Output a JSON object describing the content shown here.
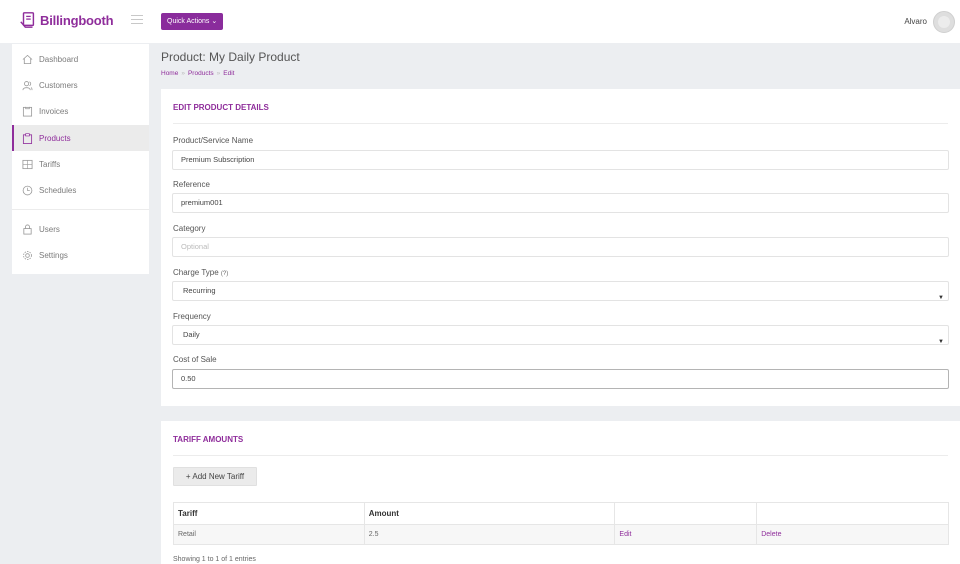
{
  "brand": {
    "name": "Billingbooth",
    "color": "#8f2d9b"
  },
  "header": {
    "quick_actions": "Quick Actions ⌄",
    "user": "Alvaro"
  },
  "sidebar": {
    "items": [
      {
        "label": "Dashboard",
        "icon": "home-icon"
      },
      {
        "label": "Customers",
        "icon": "users-icon"
      },
      {
        "label": "Invoices",
        "icon": "invoice-icon"
      },
      {
        "label": "Products",
        "icon": "clipboard-icon",
        "active": true
      },
      {
        "label": "Tariffs",
        "icon": "grid-icon"
      },
      {
        "label": "Schedules",
        "icon": "clock-icon"
      },
      {
        "label": "Users",
        "icon": "lock-icon"
      },
      {
        "label": "Settings",
        "icon": "gear-icon"
      }
    ]
  },
  "page": {
    "title": "Product: My Daily Product",
    "breadcrumb": [
      "Home",
      "Products",
      "Edit"
    ],
    "breadcrumb_sep": "»"
  },
  "product_form": {
    "title": "EDIT PRODUCT DETAILS",
    "name_label": "Product/Service Name",
    "name_value": "Premium Subscription",
    "reference_label": "Reference",
    "reference_value": "premium001",
    "category_label": "Category",
    "category_placeholder": "Optional",
    "charge_type_label": "Charge Type",
    "charge_type_help": "(?)",
    "charge_type_value": "Recurring",
    "frequency_label": "Frequency",
    "frequency_value": "Daily",
    "cost_label": "Cost of Sale",
    "cost_value": "0.50",
    "dropdown_caret": "▼"
  },
  "tariffs": {
    "title": "TARIFF AMOUNTS",
    "add_button": "+ Add New Tariff",
    "columns": [
      "Tariff",
      "Amount",
      "",
      ""
    ],
    "rows": [
      {
        "tariff": "Retail",
        "amount": "2.5",
        "edit": "Edit",
        "delete": "Delete"
      }
    ],
    "footer": "Showing 1 to 1 of 1 entries"
  }
}
